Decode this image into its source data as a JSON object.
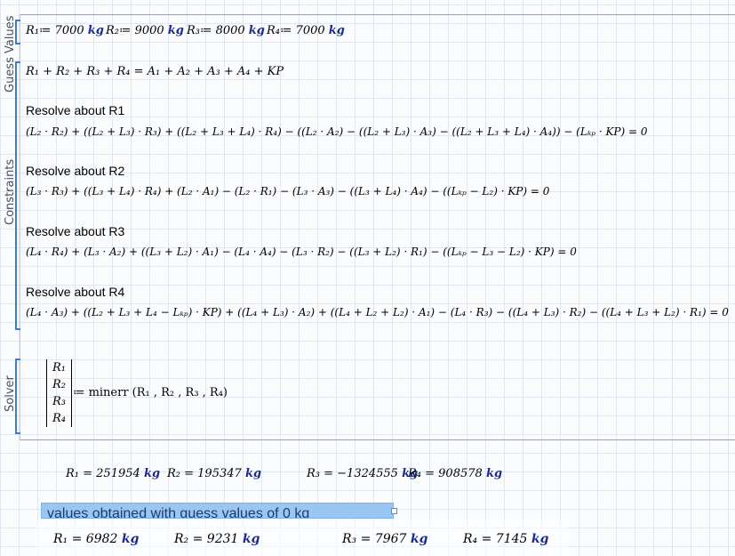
{
  "regions": {
    "guess_values": "Guess Values",
    "constraints": "Constraints",
    "solver": "Solver"
  },
  "guess": {
    "r1": "R₁≔ 7000",
    "r2": "R₂≔ 9000",
    "r3": "R₃≔ 8000",
    "r4": "R₄≔ 7000",
    "unit": "kg"
  },
  "constraints": {
    "balance": "R₁ + R₂ + R₃ + R₄ = A₁ + A₂ + A₃ + A₄ + KP",
    "h1": "Resolve about R1",
    "eq1": "(L₂ · R₂) + ((L₂ + L₃) · R₃) + ((L₂ + L₃ + L₄) · R₄) − ((L₂ · A₂) − ((L₂ + L₃) · A₃) − ((L₂ + L₃ + L₄) · A₄)) − (Lₖₚ · KP) = 0",
    "h2": "Resolve about R2",
    "eq2": "(L₃ · R₃) + ((L₃ + L₄) · R₄) + (L₂ · A₁) − (L₂ · R₁) − (L₃ · A₃) − ((L₃ + L₄) · A₄) − ((Lₖₚ − L₂) · KP) = 0",
    "h3": "Resolve about R3",
    "eq3": "(L₄ · R₄) + (L₃ · A₂) + ((L₃ + L₂) · A₁) − (L₄ · A₄) − (L₃ · R₂) − ((L₃ + L₂) · R₁) − ((Lₖₚ − L₃ − L₂) · KP) = 0",
    "h4": "Resolve about R4",
    "eq4": "(L₄ · A₃) + ((L₂ + L₃ + L₄ − Lₖₚ) · KP) + ((L₄ + L₃) · A₂) + ((L₄ + L₂ + L₂) · A₁) − (L₄ · R₃) − ((L₄ + L₃) · R₂) − ((L₄ + L₃ + L₂) · R₁) = 0"
  },
  "solver": {
    "m1": "R₁",
    "m2": "R₂",
    "m3": "R₃",
    "m4": "R₄",
    "call": "≔ minerr (R₁ , R₂ , R₃ , R₄)"
  },
  "results": {
    "r1": "R₁ = 251954",
    "r2": "R₂ = 195347",
    "r3": "R₃ = −1324555",
    "r4": "R₄ = 908578",
    "unit": "kg"
  },
  "note": "values obtained with guess values of 0 kg",
  "results0": {
    "r1": "R₁ = 6982",
    "r2": "R₂ = 9231",
    "r3": "R₃ = 7967",
    "r4": "R₄ = 7145",
    "unit": "kg"
  }
}
